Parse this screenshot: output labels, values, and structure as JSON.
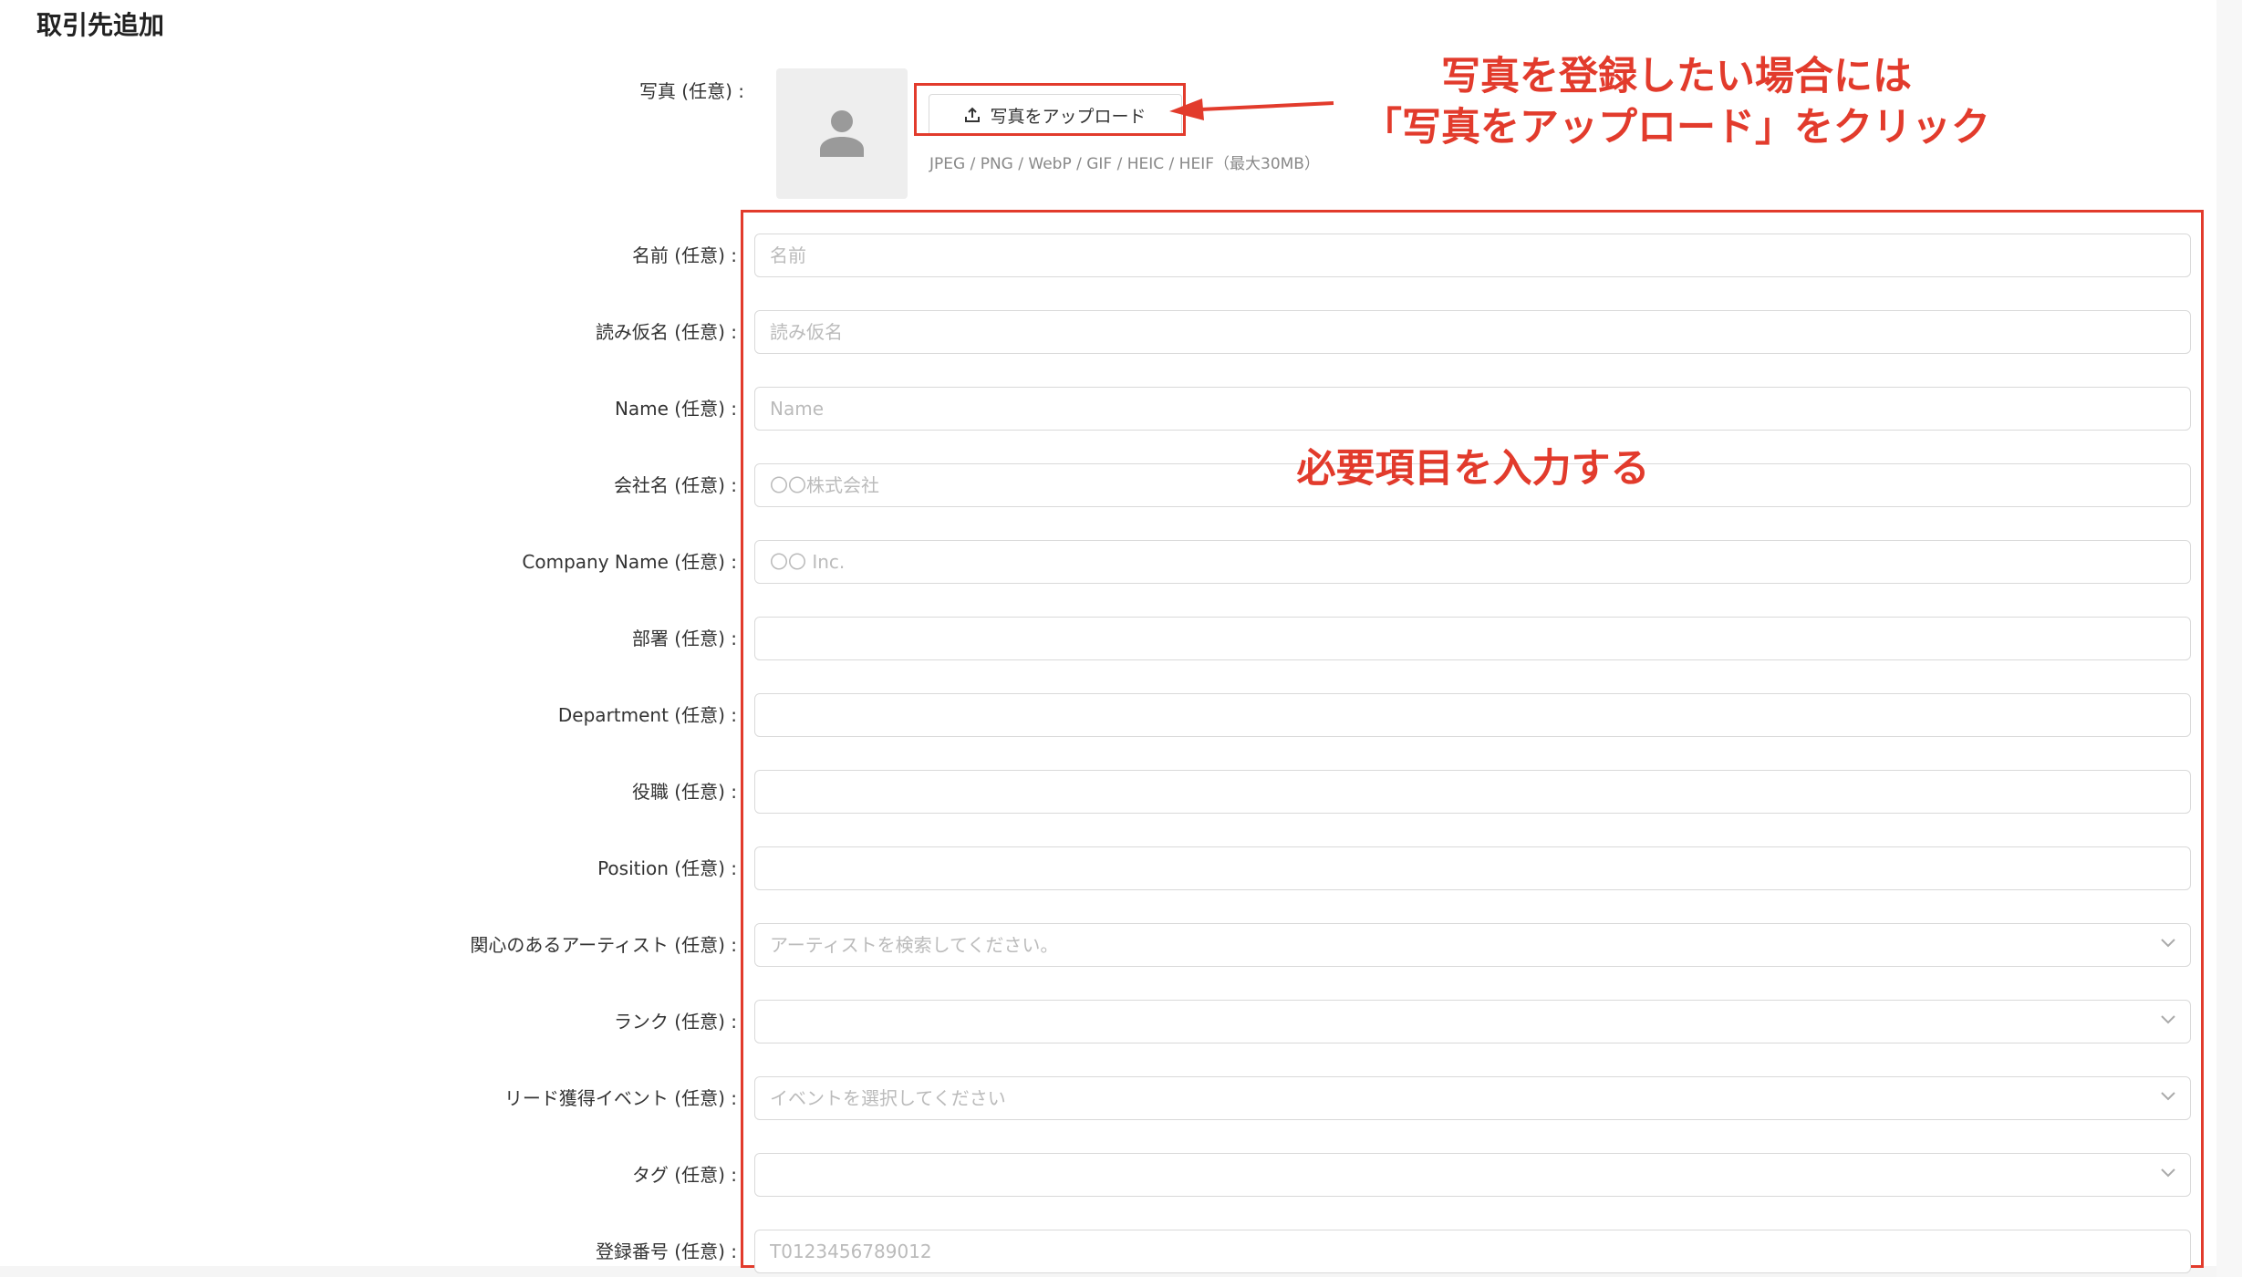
{
  "page": {
    "title": "取引先追加"
  },
  "photo": {
    "label": "写真 (任意) :",
    "upload_label": "写真をアップロード",
    "file_hint": "JPEG / PNG / WebP / GIF / HEIC / HEIF（最大30MB）",
    "avatar_icon": "user-avatar-icon",
    "upload_icon": "upload-icon"
  },
  "annotations": {
    "upload_callout_line1": "写真を登録したい場合には",
    "upload_callout_line2": "「写真をアップロード」をクリック",
    "form_callout": "必要項目を入力する",
    "accent_color": "#e23b2c"
  },
  "fields": {
    "name": {
      "label": "名前 (任意) :",
      "placeholder": "名前",
      "value": ""
    },
    "kana": {
      "label": "読み仮名 (任意) :",
      "placeholder": "読み仮名",
      "value": ""
    },
    "name_en": {
      "label": "Name (任意) :",
      "placeholder": "Name",
      "value": ""
    },
    "company": {
      "label": "会社名 (任意) :",
      "placeholder": "〇〇株式会社",
      "value": ""
    },
    "company_en": {
      "label": "Company Name (任意) :",
      "placeholder": "〇〇 Inc.",
      "value": ""
    },
    "department": {
      "label": "部署 (任意) :",
      "placeholder": "",
      "value": ""
    },
    "department_en": {
      "label": "Department (任意) :",
      "placeholder": "",
      "value": ""
    },
    "position": {
      "label": "役職 (任意) :",
      "placeholder": "",
      "value": ""
    },
    "position_en": {
      "label": "Position (任意) :",
      "placeholder": "",
      "value": ""
    },
    "artists": {
      "label": "関心のあるアーティスト (任意) :",
      "placeholder": "アーティストを検索してください。"
    },
    "rank": {
      "label": "ランク (任意) :",
      "placeholder": ""
    },
    "lead_event": {
      "label": "リード獲得イベント (任意) :",
      "placeholder": "イベントを選択してください"
    },
    "tags": {
      "label": "タグ (任意) :",
      "placeholder": ""
    },
    "registration_number": {
      "label": "登録番号 (任意) :",
      "placeholder": "T0123456789012",
      "value": ""
    }
  },
  "icons": {
    "select_chevron": "chevron-down-icon"
  }
}
